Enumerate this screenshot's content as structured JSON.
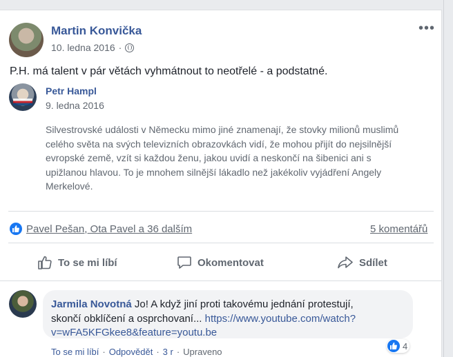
{
  "post": {
    "author": "Martin Konvička",
    "date": "10. ledna 2016",
    "separator": "·",
    "more": "•••",
    "text": "P.H. má talent v pár větách vyhmátnout to neotřelé - a podstatné."
  },
  "shared": {
    "author": "Petr Hampl",
    "date": "9. ledna 2016",
    "lines": [
      "Silvestrovské události v Německu mimo jiné znamenají, že stovky milionů muslimů",
      "celého světa na svých televizních obrazovkách vidí, že mohou přijít do nejsilnější",
      "evropské země, vzít si každou ženu, jakou uvidí a neskončí na šibenici ani s",
      "upižlanou hlavou. To je mnohem silnější lákadlo než jakékoliv vyjádření Angely",
      "Merkelové."
    ]
  },
  "reactions": {
    "text": "Pavel Pešan, Ota Pavel a 36 dalším",
    "comments": "5 komentářů"
  },
  "actions": {
    "like": "To se mi líbí",
    "comment": "Okomentovat",
    "share": "Sdílet"
  },
  "comment": {
    "author": "Jarmila Novotná",
    "text1": " Jo! A když jiní proti takovému jednání protestují,",
    "text2": "skončí obklíčení a osprchovaní... ",
    "link1": "https://www.youtube.com/watch?",
    "link2": "v=wFA5KFGkee8&feature=youtu.be",
    "likes": "4",
    "like_label": "To se mi líbí",
    "reply_label": "Odpovědět",
    "sep": "·",
    "time": "3 r",
    "edited": "Upraveno"
  },
  "colors": {
    "link": "#385898",
    "secondary": "#606770",
    "like_blue": "#1877f2"
  }
}
